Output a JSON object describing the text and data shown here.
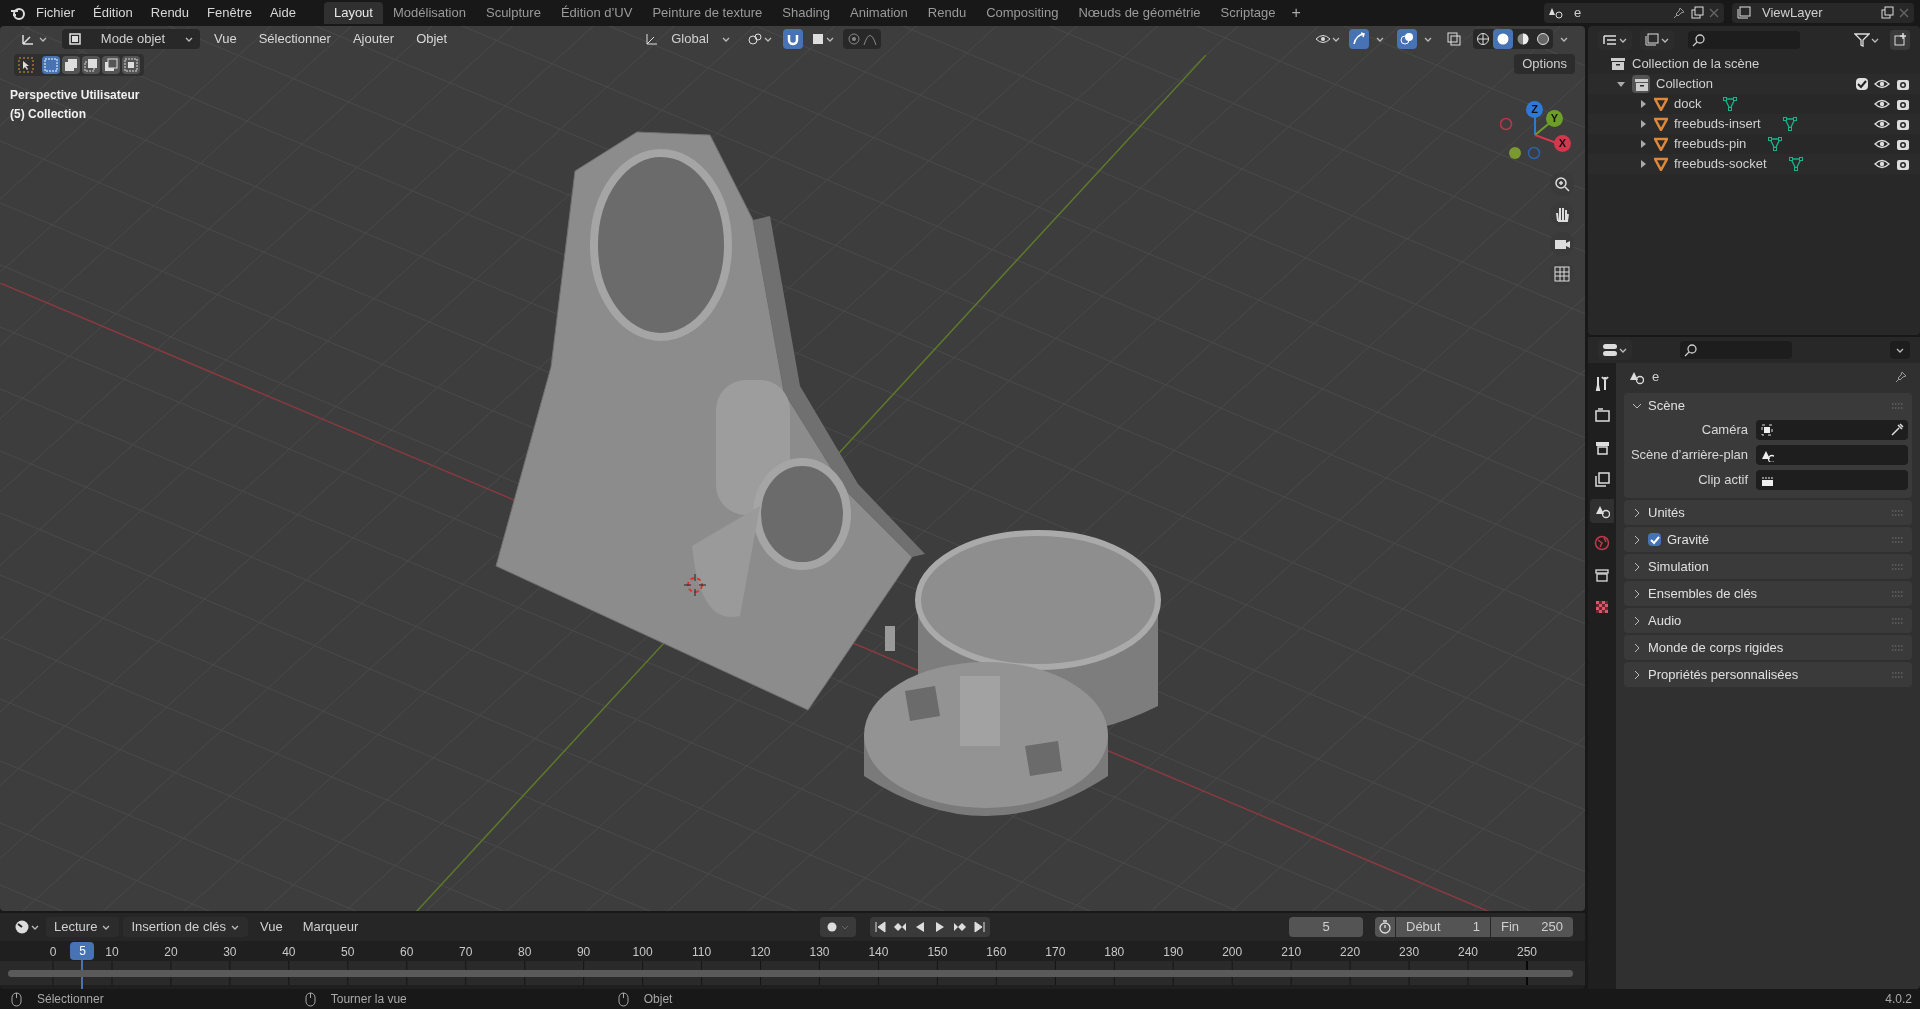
{
  "menu": {
    "items": [
      "Fichier",
      "Édition",
      "Rendu",
      "Fenêtre",
      "Aide"
    ]
  },
  "workspaces": [
    {
      "label": "Layout",
      "selected": true
    },
    {
      "label": "Modélisation",
      "selected": false
    },
    {
      "label": "Sculpture",
      "selected": false
    },
    {
      "label": "Édition d’UV",
      "selected": false
    },
    {
      "label": "Peinture de texture",
      "selected": false
    },
    {
      "label": "Shading",
      "selected": false
    },
    {
      "label": "Animation",
      "selected": false
    },
    {
      "label": "Rendu",
      "selected": false
    },
    {
      "label": "Compositing",
      "selected": false
    },
    {
      "label": "Nœuds de géométrie",
      "selected": false
    },
    {
      "label": "Scriptage",
      "selected": false
    }
  ],
  "add_workspace": "+",
  "scene_field": {
    "value": "e"
  },
  "view_layer_field": {
    "value": "ViewLayer"
  },
  "viewport": {
    "mode": "Mode objet",
    "menus": [
      "Vue",
      "Sélectionner",
      "Ajouter",
      "Objet"
    ],
    "orientation": "Global",
    "snap": true,
    "options": "Options",
    "view_name": "Perspective Utilisateur",
    "collection_label": "(5) Collection",
    "select_modes": [
      {
        "selected": true
      },
      {
        "selected": false
      },
      {
        "selected": false
      },
      {
        "selected": false
      },
      {
        "selected": false
      }
    ],
    "shading_modes": [
      {
        "kind": "wireframe",
        "selected": false
      },
      {
        "kind": "solid",
        "selected": true
      },
      {
        "kind": "material",
        "selected": false
      },
      {
        "kind": "rendered",
        "selected": false
      }
    ],
    "gizmo": {
      "x": "X",
      "y": "Y",
      "z": "Z"
    }
  },
  "outliner": {
    "root": "Collection de la scène",
    "collections": [
      {
        "name": "Collection",
        "expanded": true,
        "checked": true,
        "children": [
          {
            "name": "dock",
            "expanded": false
          },
          {
            "name": "freebuds-insert",
            "expanded": false
          },
          {
            "name": "freebuds-pin",
            "expanded": false
          },
          {
            "name": "freebuds-socket",
            "expanded": false
          }
        ]
      }
    ]
  },
  "properties": {
    "tabs": [
      {
        "kind": "tool",
        "selected": false
      },
      {
        "kind": "render",
        "selected": false
      },
      {
        "kind": "output",
        "selected": false
      },
      {
        "kind": "view_layer",
        "selected": false
      },
      {
        "kind": "scene",
        "selected": true
      },
      {
        "kind": "world",
        "selected": false
      },
      {
        "kind": "collection",
        "selected": false
      },
      {
        "kind": "texture",
        "selected": false
      }
    ],
    "header": "e",
    "panels": [
      {
        "title": "Scène",
        "expanded": true,
        "fields": [
          {
            "label": "Caméra",
            "kind": "camera"
          },
          {
            "label": "Scène d’arrière-plan",
            "kind": "scene"
          },
          {
            "label": "Clip actif",
            "kind": "clip"
          }
        ]
      },
      {
        "title": "Unités",
        "expanded": false
      },
      {
        "title": "Gravité",
        "expanded": false,
        "checked": true
      },
      {
        "title": "Simulation",
        "expanded": false
      },
      {
        "title": "Ensembles de clés",
        "expanded": false
      },
      {
        "title": "Audio",
        "expanded": false
      },
      {
        "title": "Monde de corps rigides",
        "expanded": false
      },
      {
        "title": "Propriétés personnalisées",
        "expanded": false
      }
    ]
  },
  "timeline": {
    "menus": [
      "Lecture",
      "Insertion de clés",
      "Vue",
      "Marqueur"
    ],
    "current_frame": "5",
    "start_label": "Début",
    "start": "1",
    "end_label": "Fin",
    "end": "250",
    "playhead": "5",
    "ticks": [
      "0",
      "10",
      "20",
      "30",
      "40",
      "50",
      "60",
      "70",
      "80",
      "90",
      "100",
      "110",
      "120",
      "130",
      "140",
      "150",
      "160",
      "170",
      "180",
      "190",
      "200",
      "210",
      "220",
      "230",
      "240",
      "250"
    ]
  },
  "status_bar": {
    "hints": [
      "Sélectionner",
      "Tourner la vue",
      "Objet"
    ],
    "version": "4.0.2"
  }
}
